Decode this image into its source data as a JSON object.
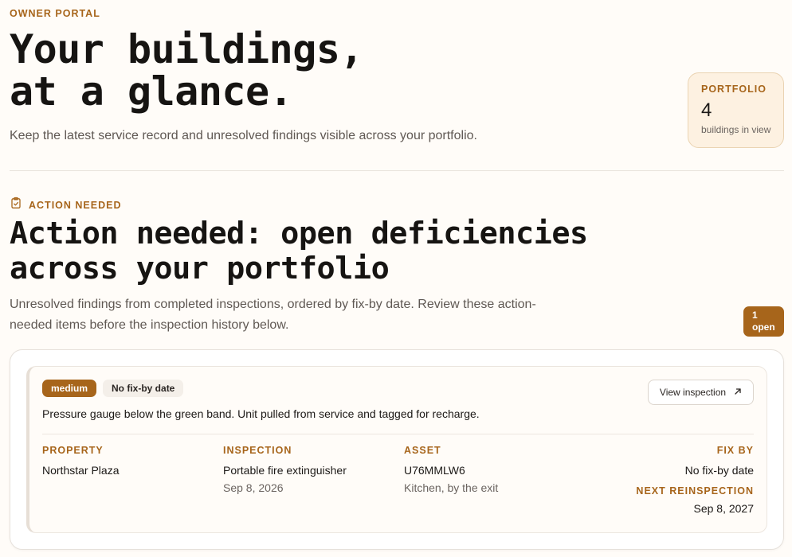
{
  "header": {
    "eyebrow": "OWNER PORTAL",
    "title": "Your buildings,\nat a glance.",
    "subtitle": "Keep the latest service record and unresolved findings visible across your portfolio."
  },
  "portfolio": {
    "label": "PORTFOLIO",
    "count": "4",
    "caption": "buildings in view"
  },
  "action_section": {
    "eyebrow": "ACTION NEEDED",
    "title": "Action needed: open deficiencies\nacross your portfolio",
    "subtitle": "Unresolved findings from completed inspections, ordered by fix-by date. Review these action-needed items before the inspection history below.",
    "badge_count": "1",
    "badge_label": "open"
  },
  "finding": {
    "severity": "medium",
    "fix_tag": "No fix-by date",
    "view_button": "View inspection",
    "description": "Pressure gauge below the green band. Unit pulled from service and tagged for recharge.",
    "property_label": "PROPERTY",
    "property": "Northstar Plaza",
    "inspection_label": "INSPECTION",
    "inspection": "Portable fire extinguisher",
    "inspection_date": "Sep 8, 2026",
    "asset_label": "ASSET",
    "asset": "U76MMLW6",
    "asset_location": "Kitchen, by the exit",
    "fix_by_label": "FIX BY",
    "fix_by": "No fix-by date",
    "next_label": "NEXT REINSPECTION",
    "next_date": "Sep 8, 2027"
  },
  "colors": {
    "accent": "#a7651b",
    "background": "#fffcf8"
  },
  "icons": {
    "section": "clipboard-check-icon",
    "view": "arrow-up-right-icon"
  }
}
